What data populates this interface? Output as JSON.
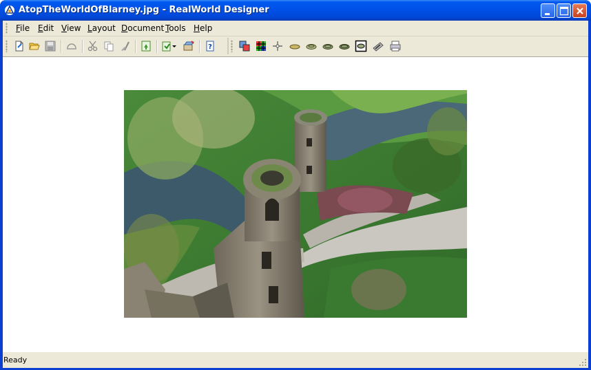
{
  "window": {
    "title": "AtopTheWorldOfBlarney.jpg - RealWorld Designer",
    "controls": [
      "minimize",
      "maximize",
      "close"
    ]
  },
  "menu": {
    "items": [
      {
        "label_u": "F",
        "label_rest": "ile"
      },
      {
        "label_u": "E",
        "label_rest": "dit"
      },
      {
        "label_u": "V",
        "label_rest": "iew"
      },
      {
        "label_u": "L",
        "label_rest": "ayout"
      },
      {
        "label_u": "D",
        "label_rest": "ocument"
      },
      {
        "label_u": "T",
        "label_rest": "ools"
      },
      {
        "label_u": "H",
        "label_rest": "elp"
      }
    ]
  },
  "toolbar": {
    "icons": [
      "new-icon",
      "open-icon",
      "save-icon",
      "undo-icon",
      "cut-icon",
      "copy-icon",
      "paste-icon",
      "export-icon",
      "wizard-icon",
      "install-icon",
      "help-icon",
      "canvas-size-icon",
      "grid-icon",
      "crosshair-icon",
      "layer-1-icon",
      "layer-2-icon",
      "layer-3-icon",
      "layer-4-icon",
      "frame-icon",
      "scanner-icon",
      "print-icon"
    ]
  },
  "document": {
    "image_subject": "Blarney Castle tower viewed from above"
  },
  "status": {
    "text": "Ready"
  },
  "colors": {
    "titlebar": "#0054e3",
    "chrome": "#ece9d8",
    "close_button": "#d4552e"
  }
}
